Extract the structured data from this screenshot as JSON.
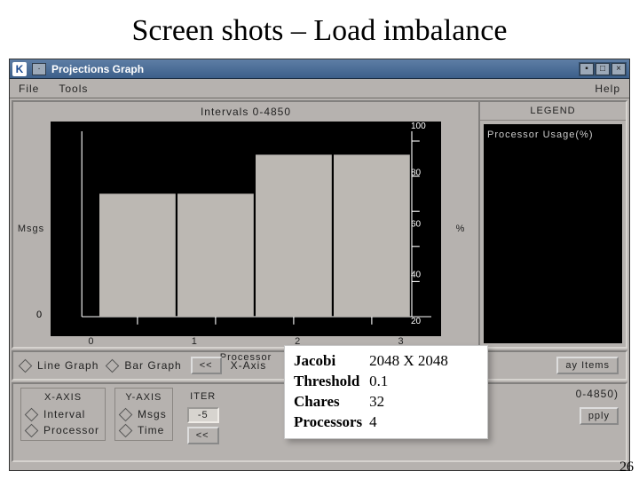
{
  "slide": {
    "title": "Screen shots – Load imbalance",
    "page": "26"
  },
  "window": {
    "title": "Projections Graph",
    "menus": [
      "File",
      "Tools",
      "Help"
    ]
  },
  "legend": {
    "title": "LEGEND",
    "entry": "Processor Usage(%)"
  },
  "controls": {
    "row1": {
      "opt1": "Line Graph",
      "opt2": "Bar Graph",
      "prev": "<<",
      "extra": "X-Axis",
      "right_btn": "ay Items"
    },
    "row2": {
      "xaxis": {
        "title": "X-AXIS",
        "opt1": "Interval",
        "opt2": "Processor"
      },
      "yaxis": {
        "title": "Y-AXIS",
        "opt1": "Msgs",
        "opt2": "Time"
      },
      "iter": {
        "title": "ITER",
        "value": "-5",
        "prev": "<<"
      },
      "range": "0-4850)",
      "apply": "pply"
    }
  },
  "overlay": {
    "rows": [
      {
        "k": "Jacobi",
        "v": "2048 X 2048"
      },
      {
        "k": "Threshold",
        "v": "0.1"
      },
      {
        "k": "Chares",
        "v": "32"
      },
      {
        "k": "Processors",
        "v": "4"
      }
    ]
  },
  "chart_data": {
    "type": "bar",
    "title": "Intervals 0-4850",
    "xlabel": "Processor",
    "y_left_label": "Msgs",
    "y_right_label": "%",
    "y_left_zero": "0",
    "categories": [
      "0",
      "1",
      "2",
      "3"
    ],
    "values": [
      70,
      70,
      92,
      92
    ],
    "y_right_ticks": [
      "100",
      "80",
      "60",
      "40",
      "20"
    ],
    "ylim_right": [
      0,
      100
    ],
    "series_name": "Processor Usage(%)"
  }
}
